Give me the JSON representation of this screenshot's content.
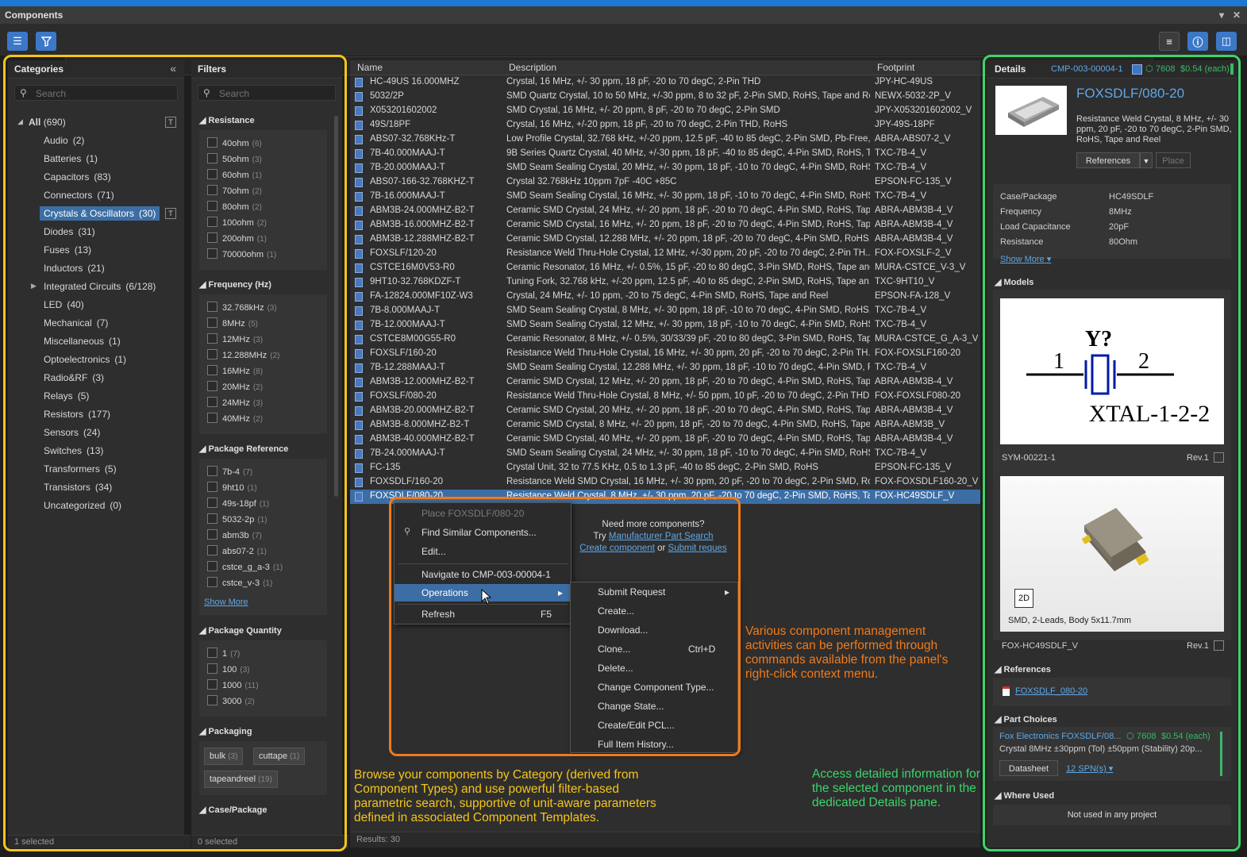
{
  "window": {
    "title": "Components"
  },
  "toolbar": {
    "search_placeholder": "Search"
  },
  "categories": {
    "header": "Categories",
    "search_placeholder": "Search",
    "all_label": "All",
    "all_count": "(690)",
    "items": [
      {
        "label": "Audio",
        "count": "(2)"
      },
      {
        "label": "Batteries",
        "count": "(1)"
      },
      {
        "label": "Capacitors",
        "count": "(83)"
      },
      {
        "label": "Connectors",
        "count": "(71)"
      },
      {
        "label": "Crystals & Oscillators",
        "count": "(30)"
      },
      {
        "label": "Diodes",
        "count": "(31)"
      },
      {
        "label": "Fuses",
        "count": "(13)"
      },
      {
        "label": "Inductors",
        "count": "(21)"
      },
      {
        "label": "Integrated Circuits",
        "count": "(6/128)"
      },
      {
        "label": "LED",
        "count": "(40)"
      },
      {
        "label": "Mechanical",
        "count": "(7)"
      },
      {
        "label": "Miscellaneous",
        "count": "(1)"
      },
      {
        "label": "Optoelectronics",
        "count": "(1)"
      },
      {
        "label": "Radio&RF",
        "count": "(3)"
      },
      {
        "label": "Relays",
        "count": "(5)"
      },
      {
        "label": "Resistors",
        "count": "(177)"
      },
      {
        "label": "Sensors",
        "count": "(24)"
      },
      {
        "label": "Switches",
        "count": "(13)"
      },
      {
        "label": "Transformers",
        "count": "(5)"
      },
      {
        "label": "Transistors",
        "count": "(34)"
      },
      {
        "label": "Uncategorized",
        "count": "(0)"
      }
    ],
    "status": "1 selected"
  },
  "filters": {
    "header": "Filters",
    "search_placeholder": "Search",
    "resistance": {
      "title": "Resistance",
      "items": [
        {
          "label": "40ohm",
          "count": "(6)"
        },
        {
          "label": "50ohm",
          "count": "(3)"
        },
        {
          "label": "60ohm",
          "count": "(1)"
        },
        {
          "label": "70ohm",
          "count": "(2)"
        },
        {
          "label": "80ohm",
          "count": "(2)"
        },
        {
          "label": "100ohm",
          "count": "(2)"
        },
        {
          "label": "200ohm",
          "count": "(1)"
        },
        {
          "label": "70000ohm",
          "count": "(1)"
        }
      ]
    },
    "frequency": {
      "title": "Frequency (Hz)",
      "items": [
        {
          "label": "32.768kHz",
          "count": "(3)"
        },
        {
          "label": "8MHz",
          "count": "(5)"
        },
        {
          "label": "12MHz",
          "count": "(3)"
        },
        {
          "label": "12.288MHz",
          "count": "(2)"
        },
        {
          "label": "16MHz",
          "count": "(8)"
        },
        {
          "label": "20MHz",
          "count": "(2)"
        },
        {
          "label": "24MHz",
          "count": "(3)"
        },
        {
          "label": "40MHz",
          "count": "(2)"
        }
      ]
    },
    "package_reference": {
      "title": "Package Reference",
      "items": [
        {
          "label": "7b-4",
          "count": "(7)"
        },
        {
          "label": "9ht10",
          "count": "(1)"
        },
        {
          "label": "49s-18pf",
          "count": "(1)"
        },
        {
          "label": "5032-2p",
          "count": "(1)"
        },
        {
          "label": "abm3b",
          "count": "(7)"
        },
        {
          "label": "abs07-2",
          "count": "(1)"
        },
        {
          "label": "cstce_g_a-3",
          "count": "(1)"
        },
        {
          "label": "cstce_v-3",
          "count": "(1)"
        }
      ],
      "show_more": "Show More"
    },
    "package_quantity": {
      "title": "Package Quantity",
      "items": [
        {
          "label": "1",
          "count": "(7)"
        },
        {
          "label": "100",
          "count": "(3)"
        },
        {
          "label": "1000",
          "count": "(11)"
        },
        {
          "label": "3000",
          "count": "(2)"
        }
      ]
    },
    "packaging": {
      "title": "Packaging",
      "chips": [
        {
          "label": "bulk",
          "count": "(3)"
        },
        {
          "label": "cuttape",
          "count": "(1)"
        },
        {
          "label": "tapeandreel",
          "count": "(19)"
        }
      ]
    },
    "case_package": {
      "title": "Case/Package"
    },
    "status": "0 selected"
  },
  "grid": {
    "columns": {
      "name": "Name",
      "description": "Description",
      "footprint": "Footprint"
    },
    "rows": [
      {
        "name": "HC-49US 16.000MHZ",
        "desc": "Crystal, 16 MHz, +/- 30 ppm, 18 pF, -20 to 70 degC, 2-Pin THD",
        "fp": "JPY-HC-49US"
      },
      {
        "name": "5032/2P",
        "desc": "SMD Quartz Crystal, 10 to 50 MHz, +/-30 ppm, 8 to 32 pF, 2-Pin SMD, RoHS, Tape and Reel",
        "fp": "NEWX-5032-2P_V"
      },
      {
        "name": "X053201602002",
        "desc": "SMD Crystal, 16 MHz, +/- 20 ppm, 8 pF, -20 to 70 degC, 2-Pin SMD",
        "fp": "JPY-X053201602002_V"
      },
      {
        "name": "49S/18PF",
        "desc": "Crystal, 16 MHz, +/-20 ppm, 18 pF, -20 to 70 degC, 2-Pin THD, RoHS",
        "fp": "JPY-49S-18PF"
      },
      {
        "name": "ABS07-32.768KHz-T",
        "desc": "Low Profile Crystal, 32.768 kHz, +/-20 ppm, 12.5 pF, -40 to 85 degC, 2-Pin SMD, Pb-Free,...",
        "fp": "ABRA-ABS07-2_V"
      },
      {
        "name": "7B-40.000MAAJ-T",
        "desc": "9B Series Quartz Crystal, 40 MHz, +/-30 ppm, 18 pF, -40 to 85 degC, 4-Pin SMD, RoHS, Ta...",
        "fp": "TXC-7B-4_V"
      },
      {
        "name": "7B-20.000MAAJ-T",
        "desc": "SMD Seam Sealing Crystal, 20 MHz, +/- 30 ppm, 18 pF, -10 to 70 degC, 4-Pin SMD, RoHS,...",
        "fp": "TXC-7B-4_V"
      },
      {
        "name": "ABS07-166-32.768KHZ-T",
        "desc": "Crystal 32.768kHz 10ppm 7pF -40C +85C",
        "fp": "EPSON-FC-135_V"
      },
      {
        "name": "7B-16.000MAAJ-T",
        "desc": "SMD Seam Sealing Crystal, 16 MHz, +/- 30 ppm, 18 pF, -10 to 70 degC, 4-Pin SMD, RoHS,...",
        "fp": "TXC-7B-4_V"
      },
      {
        "name": "ABM3B-24.000MHZ-B2-T",
        "desc": "Ceramic SMD Crystal, 24 MHz, +/- 20 ppm, 18 pF, -20 to 70 degC, 4-Pin SMD, RoHS, Tape...",
        "fp": "ABRA-ABM3B-4_V"
      },
      {
        "name": "ABM3B-16.000MHZ-B2-T",
        "desc": "Ceramic SMD Crystal, 16 MHz, +/- 20 ppm, 18 pF, -20 to 70 degC, 4-Pin SMD, RoHS, Tape...",
        "fp": "ABRA-ABM3B-4_V"
      },
      {
        "name": "ABM3B-12.288MHZ-B2-T",
        "desc": "Ceramic SMD Crystal, 12.288 MHz, +/- 20 ppm, 18 pF, -20 to 70 degC, 4-Pin SMD, RoHS,...",
        "fp": "ABRA-ABM3B-4_V"
      },
      {
        "name": "FOXSLF/120-20",
        "desc": "Resistance Weld Thru-Hole Crystal, 12 MHz, +/-30 ppm, 20 pF, -20 to 70 degC, 2-Pin TH...",
        "fp": "FOX-FOXSLF-2_V"
      },
      {
        "name": "CSTCE16M0V53-R0",
        "desc": "Ceramic Resonator, 16 MHz, +/- 0.5%, 15 pF, -20 to 80 degC, 3-Pin SMD, RoHS, Tape and...",
        "fp": "MURA-CSTCE_V-3_V"
      },
      {
        "name": "9HT10-32.768KDZF-T",
        "desc": "Tuning Fork, 32.768 kHz, +/-20 ppm, 12.5 pF, -40 to 85 degC, 2-Pin SMD, RoHS, Tape an...",
        "fp": "TXC-9HT10_V"
      },
      {
        "name": "FA-12824.000MF10Z-W3",
        "desc": "Crystal, 24 MHz, +/- 10 ppm, -20 to 75 degC, 4-Pin SMD, RoHS, Tape and Reel",
        "fp": "EPSON-FA-128_V"
      },
      {
        "name": "7B-8.000MAAJ-T",
        "desc": "SMD Seam Sealing Crystal, 8 MHz, +/- 30 ppm, 18 pF, -10 to 70 degC, 4-Pin SMD, RoHS,...",
        "fp": "TXC-7B-4_V"
      },
      {
        "name": "7B-12.000MAAJ-T",
        "desc": "SMD Seam Sealing Crystal, 12 MHz, +/- 30 ppm, 18 pF, -10 to 70 degC, 4-Pin SMD, RoHS,...",
        "fp": "TXC-7B-4_V"
      },
      {
        "name": "CSTCE8M00G55-R0",
        "desc": "Ceramic Resonator, 8 MHz, +/- 0.5%, 30/33/39 pF, -20 to 80 degC, 3-Pin SMD, RoHS, Tap...",
        "fp": "MURA-CSTCE_G_A-3_V"
      },
      {
        "name": "FOXSLF/160-20",
        "desc": "Resistance Weld Thru-Hole Crystal, 16 MHz, +/- 30 ppm, 20 pF, -20 to 70 degC, 2-Pin TH...",
        "fp": "FOX-FOXSLF160-20"
      },
      {
        "name": "7B-12.288MAAJ-T",
        "desc": "SMD Seam Sealing Crystal, 12.288 MHz, +/- 30 ppm, 18 pF, -10 to 70 degC, 4-Pin SMD, R...",
        "fp": "TXC-7B-4_V"
      },
      {
        "name": "ABM3B-12.000MHZ-B2-T",
        "desc": "Ceramic SMD Crystal, 12 MHz, +/- 20 ppm, 18 pF, -20 to 70 degC, 4-Pin SMD, RoHS, Tape...",
        "fp": "ABRA-ABM3B-4_V"
      },
      {
        "name": "FOXSLF/080-20",
        "desc": "Resistance Weld Thru-Hole Crystal, 8 MHz, +/- 50 ppm, 10 pF, -20 to 70 degC, 2-Pin THD...",
        "fp": "FOX-FOXSLF080-20"
      },
      {
        "name": "ABM3B-20.000MHZ-B2-T",
        "desc": "Ceramic SMD Crystal, 20 MHz, +/- 20 ppm, 18 pF, -20 to 70 degC, 4-Pin SMD, RoHS, Tape...",
        "fp": "ABRA-ABM3B-4_V"
      },
      {
        "name": "ABM3B-8.000MHZ-B2-T",
        "desc": "Ceramic SMD Crystal, 8 MHz, +/- 20 ppm, 18 pF, -20 to 70 degC, 4-Pin SMD, RoHS, Tape...",
        "fp": "ABRA-ABM3B_V"
      },
      {
        "name": "ABM3B-40.000MHZ-B2-T",
        "desc": "Ceramic SMD Crystal, 40 MHz, +/- 20 ppm, 18 pF, -20 to 70 degC, 4-Pin SMD, RoHS, Tape...",
        "fp": "ABRA-ABM3B-4_V"
      },
      {
        "name": "7B-24.000MAAJ-T",
        "desc": "SMD Seam Sealing Crystal, 24 MHz, +/- 30 ppm, 18 pF, -10 to 70 degC, 4-Pin SMD, RoHS,...",
        "fp": "TXC-7B-4_V"
      },
      {
        "name": "FC-135",
        "desc": "Crystal Unit, 32 to 77.5 KHz, 0.5 to 1.3 pF, -40 to 85 degC, 2-Pin SMD, RoHS",
        "fp": "EPSON-FC-135_V"
      },
      {
        "name": "FOXSDLF/160-20",
        "desc": "Resistance Weld SMD Crystal, 16 MHz, +/- 30 ppm, 20 pF, -20 to 70 degC, 2-Pin SMD, Ro...",
        "fp": "FOX-FOXSDLF160-20_V"
      },
      {
        "name": "FOXSDLF/080-20",
        "desc": "Resistance Weld Crystal, 8 MHz, +/- 30 ppm, 20 pF, -20 to 70 degC, 2-Pin SMD, RoHS, Ta...",
        "fp": "FOX-HC49SDLF_V"
      }
    ],
    "status": "Results: 30"
  },
  "context_menu": {
    "place": "Place FOXSDLF/080-20",
    "find_similar": "Find Similar Components...",
    "edit": "Edit...",
    "navigate": "Navigate to CMP-003-00004-1",
    "operations": "Operations",
    "refresh": "Refresh",
    "refresh_key": "F5",
    "need_more": "Need more components?",
    "try": "Try",
    "mps_link": "Manufacturer Part Search",
    "create_link": "Create component",
    "or": "or",
    "submit_link": "Submit reques"
  },
  "submenu": {
    "items": [
      {
        "label": "Submit Request",
        "key": "",
        "arrow": "▸"
      },
      {
        "label": "Create...",
        "key": ""
      },
      {
        "label": "Download...",
        "key": ""
      },
      {
        "label": "Clone...",
        "key": "Ctrl+D"
      },
      {
        "label": "Delete...",
        "key": ""
      },
      {
        "label": "Change Component Type...",
        "key": ""
      },
      {
        "label": "Change State...",
        "key": ""
      },
      {
        "label": "Create/Edit PCL...",
        "key": ""
      },
      {
        "label": "Full Item History...",
        "key": ""
      }
    ]
  },
  "annotations": {
    "yellow": "Browse your components by Category (derived from Component Types) and use powerful filter-based parametric search, supportive of unit-aware parameters defined in associated Component Templates.",
    "orange": "Various component management activities can be performed through commands available from the panel's right-click context menu.",
    "green": "Access detailed information for the selected component in the dedicated Details pane.",
    "yellow_color": "#f5c518",
    "orange_color": "#f07a1a",
    "green_color": "#3cd46a"
  },
  "details": {
    "header": "Details",
    "item_id": "CMP-003-00004-1",
    "stock": "7608",
    "price": "$0.54 (each)",
    "title": "FOXSDLF/080-20",
    "description": "Resistance Weld Crystal, 8 MHz, +/- 30 ppm, 20 pF, -20 to 70 degC, 2-Pin SMD, RoHS, Tape and Reel",
    "references_btn": "References",
    "place_btn": "Place",
    "params": [
      {
        "label": "Case/Package",
        "value": "HC49SDLF"
      },
      {
        "label": "Frequency",
        "value": "8MHz"
      },
      {
        "label": "Load Capacitance",
        "value": "20pF"
      },
      {
        "label": "Resistance",
        "value": "80Ohm"
      }
    ],
    "show_more": "Show More",
    "models_title": "Models",
    "symbol": {
      "designator": "Y?",
      "pin1": "1",
      "pin2": "2",
      "comment": "XTAL-1-2-2",
      "name": "SYM-00221-1",
      "rev": "Rev.1"
    },
    "footprint": {
      "badge": "2D",
      "caption": "SMD, 2-Leads, Body 5x11.7mm",
      "name": "FOX-HC49SDLF_V",
      "rev": "Rev.1"
    },
    "references_title": "References",
    "reference_doc": "FOXSDLF_080-20",
    "part_choices_title": "Part Choices",
    "part_choice": {
      "name": "Fox Electronics FOXSDLF/08...",
      "stock": "7608",
      "price": "$0.54 (each)",
      "desc": "Crystal 8MHz ±30ppm (Tol) ±50ppm (Stability) 20p...",
      "datasheet": "Datasheet",
      "spns": "12 SPN(s)"
    },
    "where_used_title": "Where Used",
    "where_used": "Not used in any project"
  }
}
